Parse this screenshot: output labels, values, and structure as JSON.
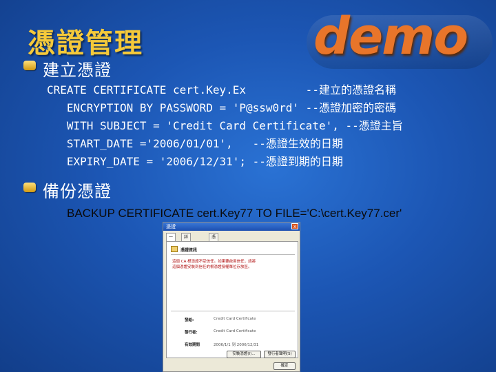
{
  "slide": {
    "title": "憑證管理",
    "logo_text": "demo",
    "section1": {
      "heading": "建立憑證",
      "code_lines": [
        "CREATE CERTIFICATE cert.Key.Ex         --建立的憑證名稱",
        "   ENCRYPTION BY PASSWORD = 'P@ssw0rd' --憑證加密的密碼",
        "   WITH SUBJECT = 'Credit Card Certificate', --憑證主旨",
        "   START_DATE ='2006/01/01',   --憑證生效的日期",
        "   EXPIRY_DATE = '2006/12/31'; --憑證到期的日期"
      ]
    },
    "section2": {
      "heading": "備份憑證",
      "command": "BACKUP CERTIFICATE cert.Key77 TO FILE='C:\\cert.Key77.cer'"
    }
  },
  "dialog": {
    "title": "憑證",
    "close_glyph": "x",
    "tabs": [
      "一般",
      "詳細資料",
      "憑證路徑"
    ],
    "info_heading": "憑證資訊",
    "warning_lines": [
      "這個 CA 根憑證不受信任。如果要啟用信任，請將",
      "這個憑證安裝到信任的根憑證授權單位存放區。"
    ],
    "fields": [
      {
        "label": "發給:",
        "value": "Credit Card Certificate"
      },
      {
        "label": "發行者:",
        "value": "Credit Card Certificate"
      },
      {
        "label": "有效期間",
        "value": "2006/1/1 到 2006/12/31"
      }
    ],
    "buttons": {
      "install": "安裝憑證(I)...",
      "issuer": "發行者聲明(S)",
      "ok": "確定"
    }
  }
}
